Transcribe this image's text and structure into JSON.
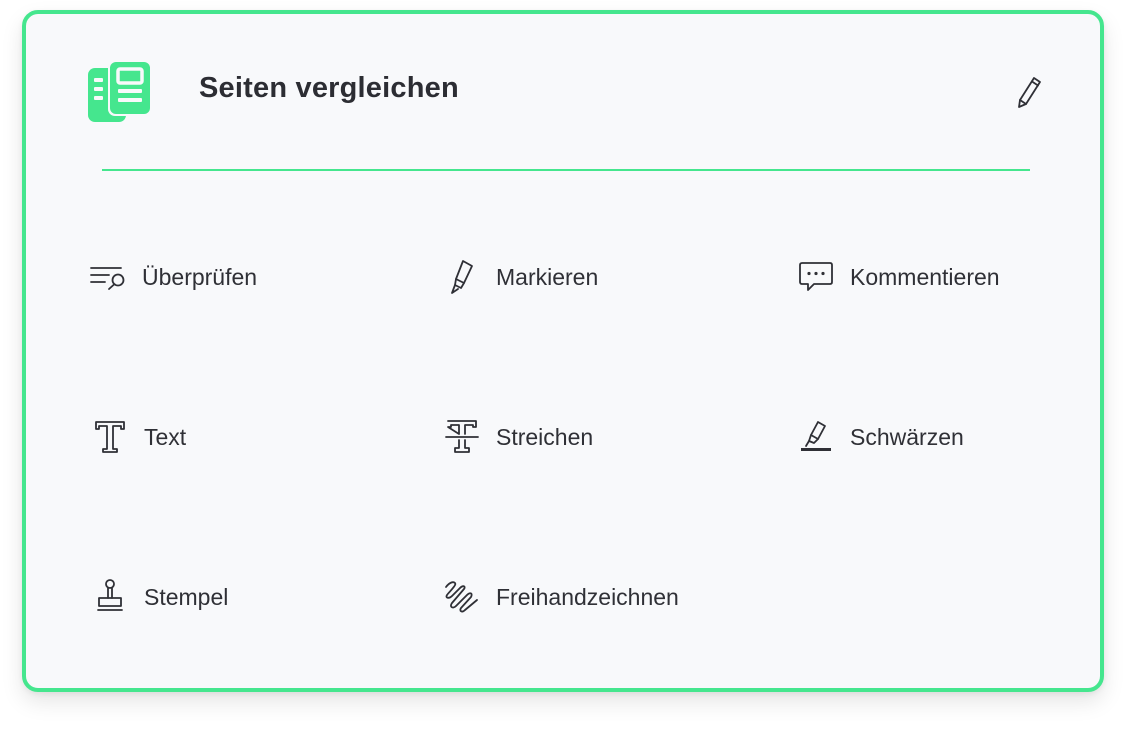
{
  "panel": {
    "title": "Seiten vergleichen",
    "app_icon": "compare-pages-icon",
    "edit_icon": "pencil-icon",
    "accent_color": "#45e68e",
    "background_color": "#f8f9fb",
    "text_color": "#2f3036"
  },
  "tools": [
    {
      "label": "Überprüfen",
      "icon": "review-search-icon"
    },
    {
      "label": "Markieren",
      "icon": "highlighter-icon"
    },
    {
      "label": "Kommentieren",
      "icon": "comment-icon"
    },
    {
      "label": "Text",
      "icon": "text-icon"
    },
    {
      "label": "Streichen",
      "icon": "strikethrough-icon"
    },
    {
      "label": "Schwärzen",
      "icon": "redact-icon"
    },
    {
      "label": "Stempel",
      "icon": "stamp-icon"
    },
    {
      "label": "Freihandzeichnen",
      "icon": "freehand-draw-icon"
    }
  ]
}
